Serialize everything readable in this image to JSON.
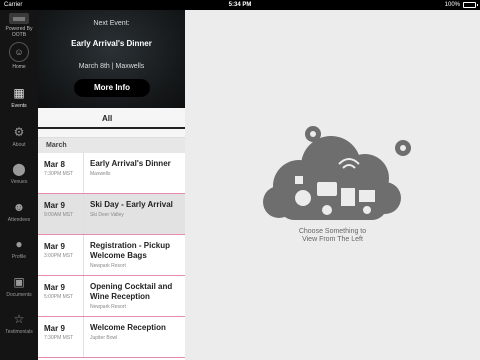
{
  "status_bar": {
    "carrier": "Carrier",
    "time": "5:34 PM",
    "battery": "100%"
  },
  "sidebar": {
    "brand_lines": [
      "Powered By",
      "OOTB"
    ],
    "items": [
      {
        "label": "Home",
        "icon": "home-icon"
      },
      {
        "label": "Events",
        "icon": "calendar-icon"
      },
      {
        "label": "About",
        "icon": "gears-icon"
      },
      {
        "label": "Venues",
        "icon": "location-pin-icon"
      },
      {
        "label": "Attendees",
        "icon": "people-icon"
      },
      {
        "label": "Profile",
        "icon": "person-icon"
      },
      {
        "label": "Documents",
        "icon": "archive-box-icon"
      },
      {
        "label": "Testimonials",
        "icon": "star-icon"
      }
    ],
    "active": "Events"
  },
  "next_event": {
    "heading": "Next Event:",
    "name": "Early Arrival's Dinner",
    "meta": "March 8th | Maxwells",
    "button": "More Info"
  },
  "tabs": {
    "active": "All"
  },
  "section": "March",
  "events": [
    {
      "date": "Mar 8",
      "time": "7:30PM MST",
      "title": "Early Arrival's Dinner",
      "venue": "Maxwells"
    },
    {
      "date": "Mar 9",
      "time": "9:00AM MST",
      "title": "Ski Day - Early Arrival",
      "venue": "Ski Deer Valley"
    },
    {
      "date": "Mar 9",
      "time": "3:00PM MST",
      "title": "Registration - Pickup Welcome Bags",
      "venue": "Newpark Resort"
    },
    {
      "date": "Mar 9",
      "time": "5:00PM MST",
      "title": "Opening Cocktail and Wine Reception",
      "venue": "Newpark Resort"
    },
    {
      "date": "Mar 9",
      "time": "7:30PM MST",
      "title": "Welcome Reception",
      "venue": "Jupiter Bowl"
    }
  ],
  "placeholder": {
    "line1": "Choose Something to",
    "line2": "View From The Left",
    "icon": "cloud-icon"
  },
  "colors": {
    "accent_divider": "#e58bb0",
    "sidebar_bg": "#141414",
    "icon_gray": "#6e6e6e"
  }
}
